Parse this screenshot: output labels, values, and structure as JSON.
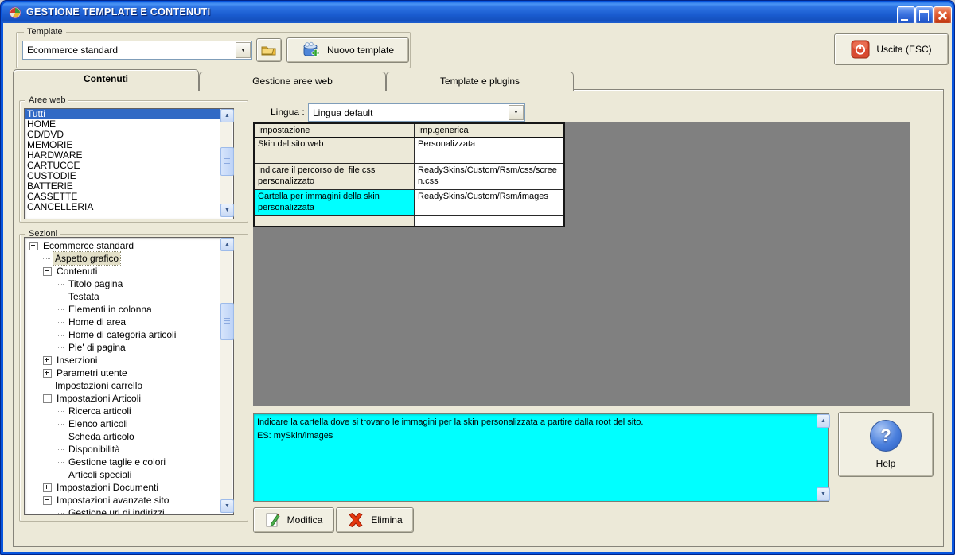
{
  "window": {
    "title": "GESTIONE TEMPLATE E CONTENUTI"
  },
  "template_section": {
    "group_label": "Template",
    "selected_template": "Ecommerce standard",
    "new_template_label": "Nuovo template",
    "exit_label": "Uscita (ESC)"
  },
  "tabs": [
    {
      "label": "Contenuti",
      "active": true
    },
    {
      "label": "Gestione aree web",
      "active": false
    },
    {
      "label": "Template e plugins",
      "active": false
    }
  ],
  "aree_web": {
    "group_label": "Aree web",
    "selected": "Tutti",
    "items": [
      "Tutti",
      "HOME",
      "CD/DVD",
      "MEMORIE",
      "HARDWARE",
      "CARTUCCE",
      "CUSTODIE",
      "BATTERIE",
      "CASSETTE",
      "CANCELLERIA"
    ]
  },
  "sezioni": {
    "group_label": "Sezioni",
    "tree": [
      {
        "label": "Ecommerce standard",
        "level": 0,
        "expander": "minus"
      },
      {
        "label": "Aspetto grafico",
        "level": 1,
        "selected": true
      },
      {
        "label": "Contenuti",
        "level": 1,
        "expander": "minus"
      },
      {
        "label": "Titolo pagina",
        "level": 2
      },
      {
        "label": "Testata",
        "level": 2
      },
      {
        "label": "Elementi in colonna",
        "level": 2
      },
      {
        "label": "Home di area",
        "level": 2
      },
      {
        "label": "Home di categoria articoli",
        "level": 2
      },
      {
        "label": "Pie' di pagina",
        "level": 2
      },
      {
        "label": "Inserzioni",
        "level": 1,
        "expander": "plus"
      },
      {
        "label": "Parametri utente",
        "level": 1,
        "expander": "plus"
      },
      {
        "label": "Impostazioni carrello",
        "level": 1
      },
      {
        "label": "Impostazioni Articoli",
        "level": 1,
        "expander": "minus"
      },
      {
        "label": "Ricerca articoli",
        "level": 2
      },
      {
        "label": "Elenco articoli",
        "level": 2
      },
      {
        "label": "Scheda articolo",
        "level": 2
      },
      {
        "label": "Disponibilità",
        "level": 2
      },
      {
        "label": "Gestione taglie e colori",
        "level": 2
      },
      {
        "label": "Articoli speciali",
        "level": 2
      },
      {
        "label": "Impostazioni Documenti",
        "level": 1,
        "expander": "plus"
      },
      {
        "label": "Impostazioni avanzate sito",
        "level": 1,
        "expander": "minus"
      },
      {
        "label": "Gestione url di indirizzi",
        "level": 2
      }
    ]
  },
  "lingua": {
    "label": "Lingua :",
    "selected": "Lingua default"
  },
  "settings_table": {
    "columns": [
      "Impostazione",
      "Imp.generica"
    ],
    "rows": [
      {
        "impostazione": "Skin del sito web",
        "valore": "Personalizzata",
        "highlighted": false
      },
      {
        "impostazione": "Indicare il percorso del file css personalizzato",
        "valore": "ReadySkins/Custom/Rsm/css/screen.css",
        "highlighted": false
      },
      {
        "impostazione": "Cartella per immagini della skin personalizzata",
        "valore": "ReadySkins/Custom/Rsm/images",
        "highlighted": true
      }
    ]
  },
  "description": {
    "line1": "Indicare la cartella dove si trovano le immagini per la skin personalizzata a partire dalla root del sito.",
    "line2": "ES: mySkin/images"
  },
  "buttons": {
    "modifica": "Modifica",
    "elimina": "Elimina",
    "help": "Help"
  },
  "colors": {
    "highlight_cyan": "#00FFFF",
    "selection_blue": "#316AC5",
    "tree_selected_bg": "#E3E0C8",
    "client_bg": "#ECE9D8",
    "panel_gray": "#808080",
    "titlebar_blue": "#1A5CD0",
    "window_border_blue": "#0855DD"
  }
}
